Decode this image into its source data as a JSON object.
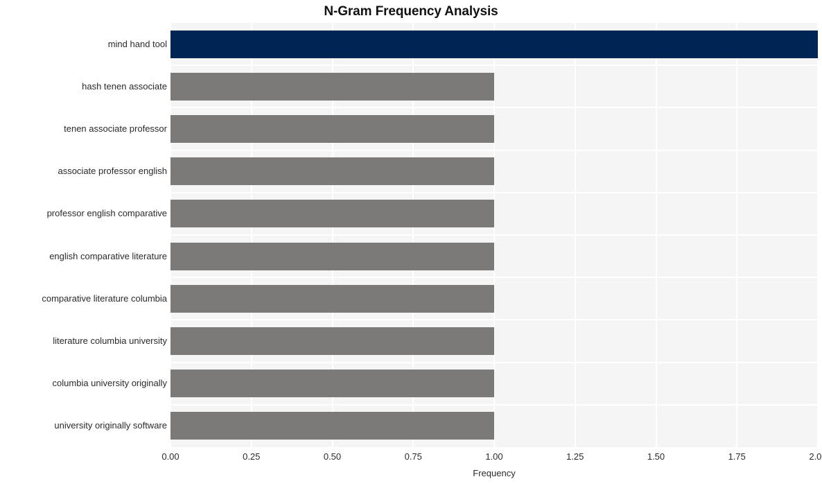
{
  "chart_data": {
    "type": "bar",
    "orientation": "horizontal",
    "title": "N-Gram Frequency Analysis",
    "xlabel": "Frequency",
    "ylabel": "",
    "categories": [
      "mind hand tool",
      "hash tenen associate",
      "tenen associate professor",
      "associate professor english",
      "professor english comparative",
      "english comparative literature",
      "comparative literature columbia",
      "literature columbia university",
      "columbia university originally",
      "university originally software"
    ],
    "values": [
      2,
      1,
      1,
      1,
      1,
      1,
      1,
      1,
      1,
      1
    ],
    "bar_colors": [
      "#002453",
      "#7c7a78",
      "#7c7a78",
      "#7c7a78",
      "#7c7a78",
      "#7c7a78",
      "#7c7a78",
      "#7c7a78",
      "#7c7a78",
      "#7c7a78"
    ],
    "xlim": [
      0,
      2
    ],
    "xticks": [
      0,
      0.25,
      0.5,
      0.75,
      1,
      1.25,
      1.5,
      1.75,
      2
    ],
    "xtick_labels": [
      "0.00",
      "0.25",
      "0.50",
      "0.75",
      "1.00",
      "1.25",
      "1.50",
      "1.75",
      "2.00"
    ],
    "grid": true,
    "grid_color": "#ffffff",
    "plot_background": "#f5f5f5",
    "figure_background": "#ffffff",
    "legend": null,
    "highlight_color": "#002453",
    "default_bar_color": "#7c7a78"
  }
}
